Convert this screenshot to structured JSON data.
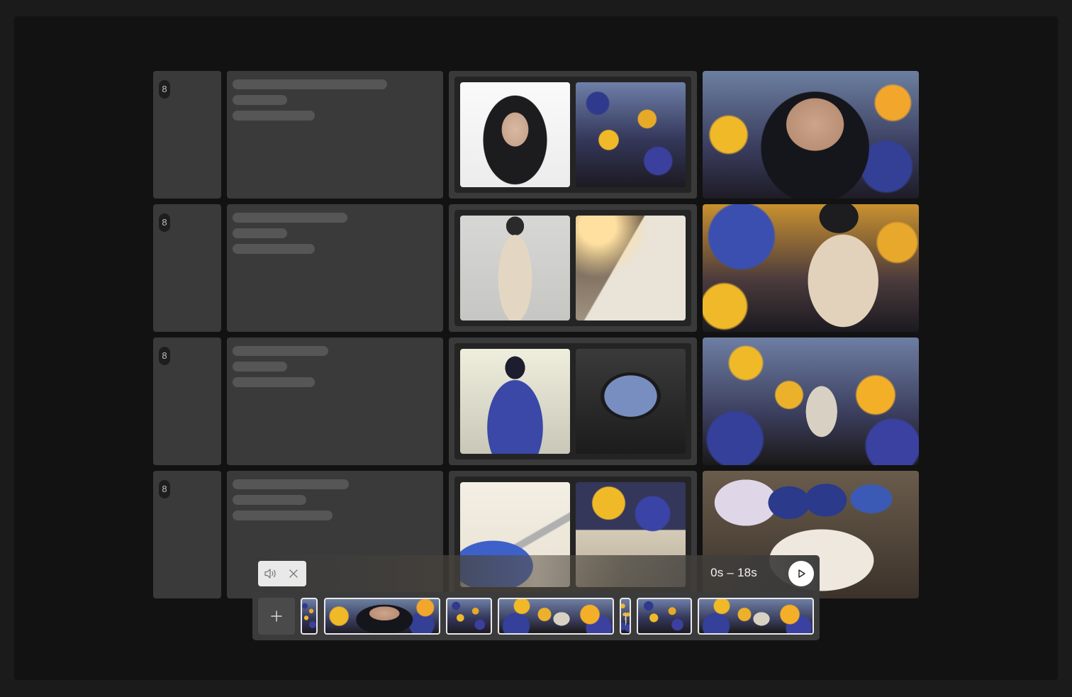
{
  "rows": [
    {
      "number": "8",
      "refs": [
        "portrait-on-white",
        "flower-field"
      ],
      "output": "girl-with-flowers-closeup"
    },
    {
      "number": "8",
      "refs": [
        "apron-dress",
        "crew-badge"
      ],
      "output": "girl-with-badge-in-flowers"
    },
    {
      "number": "8",
      "refs": [
        "figure-back-with-flowers",
        "camera-monitor"
      ],
      "output": "girl-on-swing-in-flowers"
    },
    {
      "number": "8",
      "refs": [
        "airbrush-painting",
        "palette-flowers"
      ],
      "output": "art-desk-with-sketches"
    }
  ],
  "timeline": {
    "time_range": "0s – 18s",
    "clips": [
      {
        "name": "clip-1"
      },
      {
        "name": "clip-2"
      },
      {
        "name": "clip-3"
      },
      {
        "name": "clip-4"
      },
      {
        "name": "clip-5"
      },
      {
        "name": "clip-6"
      },
      {
        "name": "clip-7"
      }
    ]
  },
  "icons": {
    "mute": "speaker-icon",
    "close": "close-icon",
    "play": "play-icon",
    "add": "plus-icon"
  },
  "colors": {
    "background": "#1b1b1b",
    "frame": "#121212",
    "cell": "#3a3a3a",
    "skeleton": "#565656",
    "accent_yellow": "#f0b928",
    "accent_blue": "#3a43a6"
  }
}
